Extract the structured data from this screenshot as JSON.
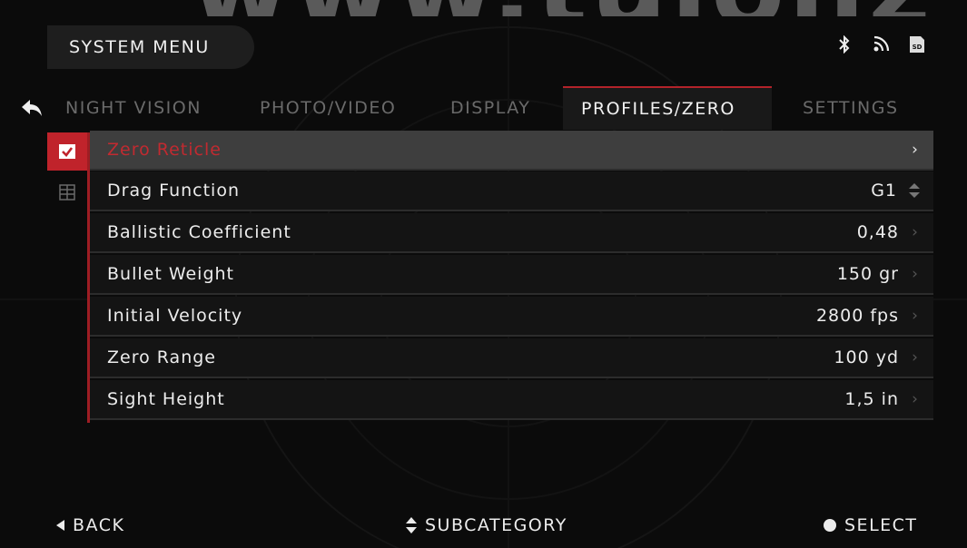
{
  "watermark": "www.tulonz",
  "header": {
    "title": "SYSTEM MENU",
    "icons": [
      "bluetooth-icon",
      "wifi-icon",
      "sd-card-icon"
    ]
  },
  "tabs": [
    {
      "label": "NIGHT VISION",
      "active": false
    },
    {
      "label": "PHOTO/VIDEO",
      "active": false
    },
    {
      "label": "DISPLAY",
      "active": false
    },
    {
      "label": "PROFILES/ZERO",
      "active": true
    },
    {
      "label": "SETTINGS",
      "active": false
    }
  ],
  "rows": [
    {
      "label": "Zero Reticle",
      "value": "",
      "control": "chevron",
      "selected": true
    },
    {
      "label": "Drag Function",
      "value": "G1",
      "control": "updown",
      "selected": false
    },
    {
      "label": "Ballistic Coefficient",
      "value": "0,48",
      "control": "chevron",
      "selected": false
    },
    {
      "label": "Bullet Weight",
      "value": "150 gr",
      "control": "chevron",
      "selected": false
    },
    {
      "label": "Initial Velocity",
      "value": "2800 fps",
      "control": "chevron",
      "selected": false
    },
    {
      "label": "Zero Range",
      "value": "100 yd",
      "control": "chevron",
      "selected": false
    },
    {
      "label": "Sight Height",
      "value": "1,5 in",
      "control": "chevron",
      "selected": false
    }
  ],
  "footer": {
    "back": "BACK",
    "subcategory": "SUBCATEGORY",
    "select": "SELECT"
  },
  "colors": {
    "accent": "#c0232b",
    "background": "#0b0b0b",
    "row": "#141414",
    "row_selected": "#3e3e3e"
  }
}
